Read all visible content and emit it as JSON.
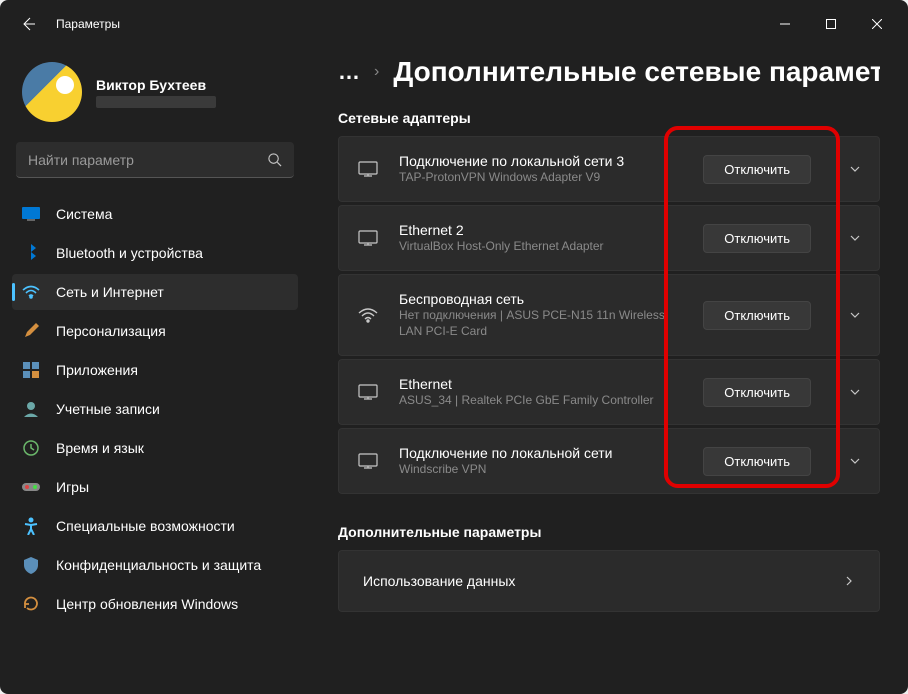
{
  "window": {
    "title": "Параметры"
  },
  "user": {
    "name": "Виктор Бухтеев"
  },
  "search": {
    "placeholder": "Найти параметр"
  },
  "nav": {
    "items": [
      {
        "label": "Система"
      },
      {
        "label": "Bluetooth и устройства"
      },
      {
        "label": "Сеть и Интернет"
      },
      {
        "label": "Персонализация"
      },
      {
        "label": "Приложения"
      },
      {
        "label": "Учетные записи"
      },
      {
        "label": "Время и язык"
      },
      {
        "label": "Игры"
      },
      {
        "label": "Специальные возможности"
      },
      {
        "label": "Конфиденциальность и защита"
      },
      {
        "label": "Центр обновления Windows"
      }
    ]
  },
  "breadcrumb": {
    "dots": "…"
  },
  "page": {
    "title": "Дополнительные сетевые параметр"
  },
  "sections": {
    "adapters": {
      "title": "Сетевые адаптеры",
      "btn": "Отключить",
      "items": [
        {
          "title": "Подключение по локальной сети 3",
          "sub": "TAP-ProtonVPN Windows Adapter V9"
        },
        {
          "title": "Ethernet 2",
          "sub": "VirtualBox Host-Only Ethernet Adapter"
        },
        {
          "title": "Беспроводная сеть",
          "sub": "Нет подключения | ASUS PCE-N15 11n Wireless LAN PCI-E Card"
        },
        {
          "title": "Ethernet",
          "sub": "ASUS_34 | Realtek PCIe GbE Family Controller"
        },
        {
          "title": "Подключение по локальной сети",
          "sub": "Windscribe VPN"
        }
      ]
    },
    "more": {
      "title": "Дополнительные параметры",
      "items": [
        {
          "title": "Использование данных"
        }
      ]
    }
  }
}
